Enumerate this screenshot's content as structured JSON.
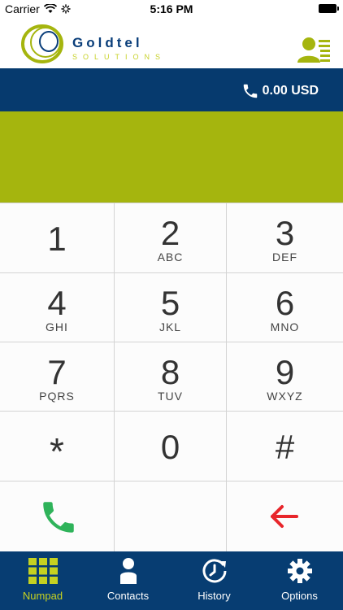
{
  "status_bar": {
    "carrier": "Carrier",
    "time": "5:16 PM"
  },
  "header": {
    "logo_name": "Goldtel",
    "logo_subtitle": "SOLUTIONS",
    "contact_icon": "contact-card-icon"
  },
  "balance": {
    "amount": "0.00 USD",
    "icon": "phone-icon"
  },
  "display": {
    "number": ""
  },
  "keypad": {
    "keys": [
      {
        "digit": "1",
        "letters": ""
      },
      {
        "digit": "2",
        "letters": "ABC"
      },
      {
        "digit": "3",
        "letters": "DEF"
      },
      {
        "digit": "4",
        "letters": "GHI"
      },
      {
        "digit": "5",
        "letters": "JKL"
      },
      {
        "digit": "6",
        "letters": "MNO"
      },
      {
        "digit": "7",
        "letters": "PQRS"
      },
      {
        "digit": "8",
        "letters": "TUV"
      },
      {
        "digit": "9",
        "letters": "WXYZ"
      },
      {
        "digit": "*",
        "letters": ""
      },
      {
        "digit": "0",
        "letters": ""
      },
      {
        "digit": "#",
        "letters": ""
      }
    ],
    "call_icon": "call-icon",
    "backspace_icon": "back-arrow-icon"
  },
  "tabs": [
    {
      "label": "Numpad",
      "icon": "grid-icon",
      "active": true
    },
    {
      "label": "Contacts",
      "icon": "person-icon",
      "active": false
    },
    {
      "label": "History",
      "icon": "clock-history-icon",
      "active": false
    },
    {
      "label": "Options",
      "icon": "gear-icon",
      "active": false
    }
  ],
  "colors": {
    "brand_navy": "#063a6e",
    "brand_lime": "#a5b50e",
    "accent_green": "#2fb35a",
    "accent_red": "#e8262b"
  }
}
